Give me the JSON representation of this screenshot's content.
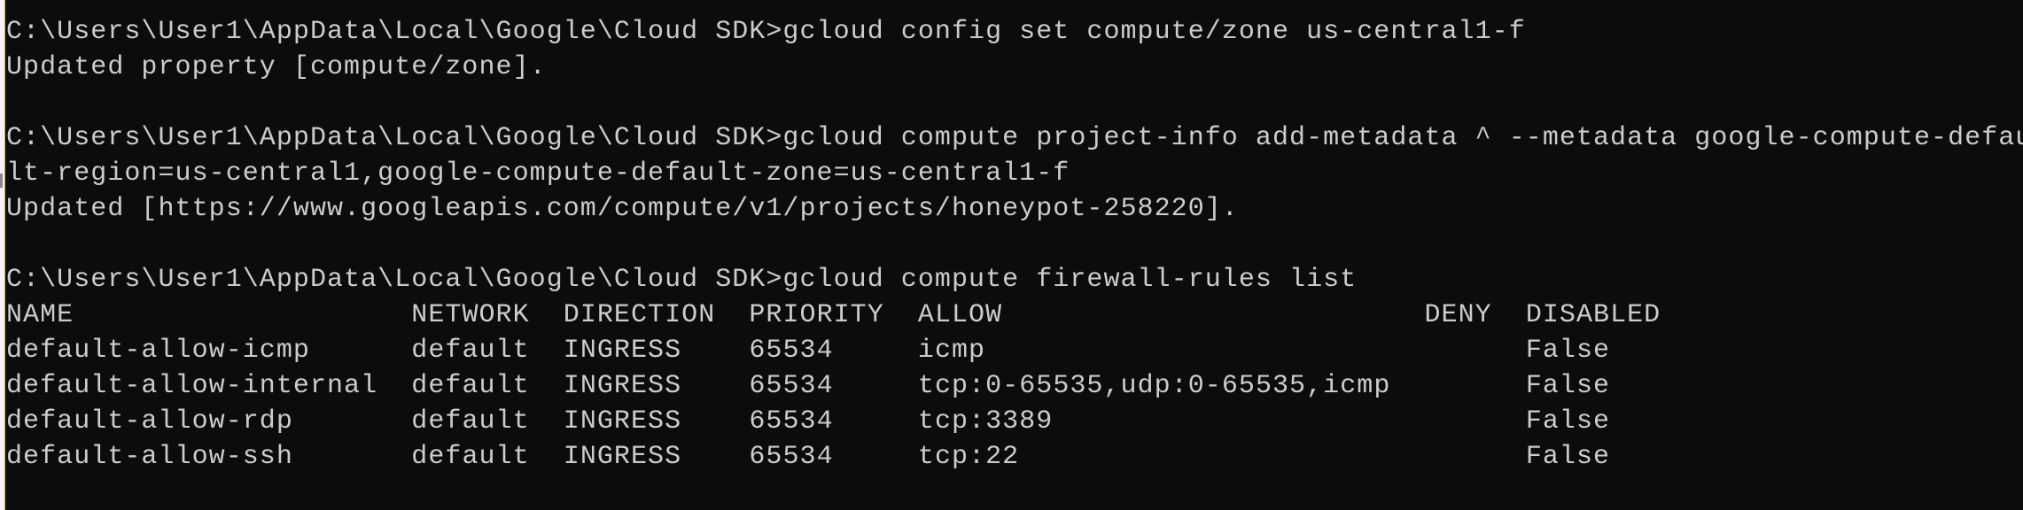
{
  "window": {
    "background": "#0c0c0c",
    "foreground": "#cccccc"
  },
  "lines": [
    "C:\\Users\\User1\\AppData\\Local\\Google\\Cloud SDK>gcloud config set compute/zone us-central1-f",
    "Updated property [compute/zone].",
    "",
    "C:\\Users\\User1\\AppData\\Local\\Google\\Cloud SDK>gcloud compute project-info add-metadata ^ --metadata google-compute-defau",
    "lt-region=us-central1,google-compute-default-zone=us-central1-f",
    "Updated [https://www.googleapis.com/compute/v1/projects/honeypot-258220].",
    "",
    "C:\\Users\\User1\\AppData\\Local\\Google\\Cloud SDK>gcloud compute firewall-rules list"
  ],
  "table": {
    "columns": [
      "NAME",
      "NETWORK",
      "DIRECTION",
      "PRIORITY",
      "ALLOW",
      "DENY",
      "DISABLED"
    ],
    "rows": [
      [
        "default-allow-icmp",
        "default",
        "INGRESS",
        "65534",
        "icmp",
        "",
        "False"
      ],
      [
        "default-allow-internal",
        "default",
        "INGRESS",
        "65534",
        "tcp:0-65535,udp:0-65535,icmp",
        "",
        "False"
      ],
      [
        "default-allow-rdp",
        "default",
        "INGRESS",
        "65534",
        "tcp:3389",
        "",
        "False"
      ],
      [
        "default-allow-ssh",
        "default",
        "INGRESS",
        "65534",
        "tcp:22",
        "",
        "False"
      ]
    ]
  }
}
